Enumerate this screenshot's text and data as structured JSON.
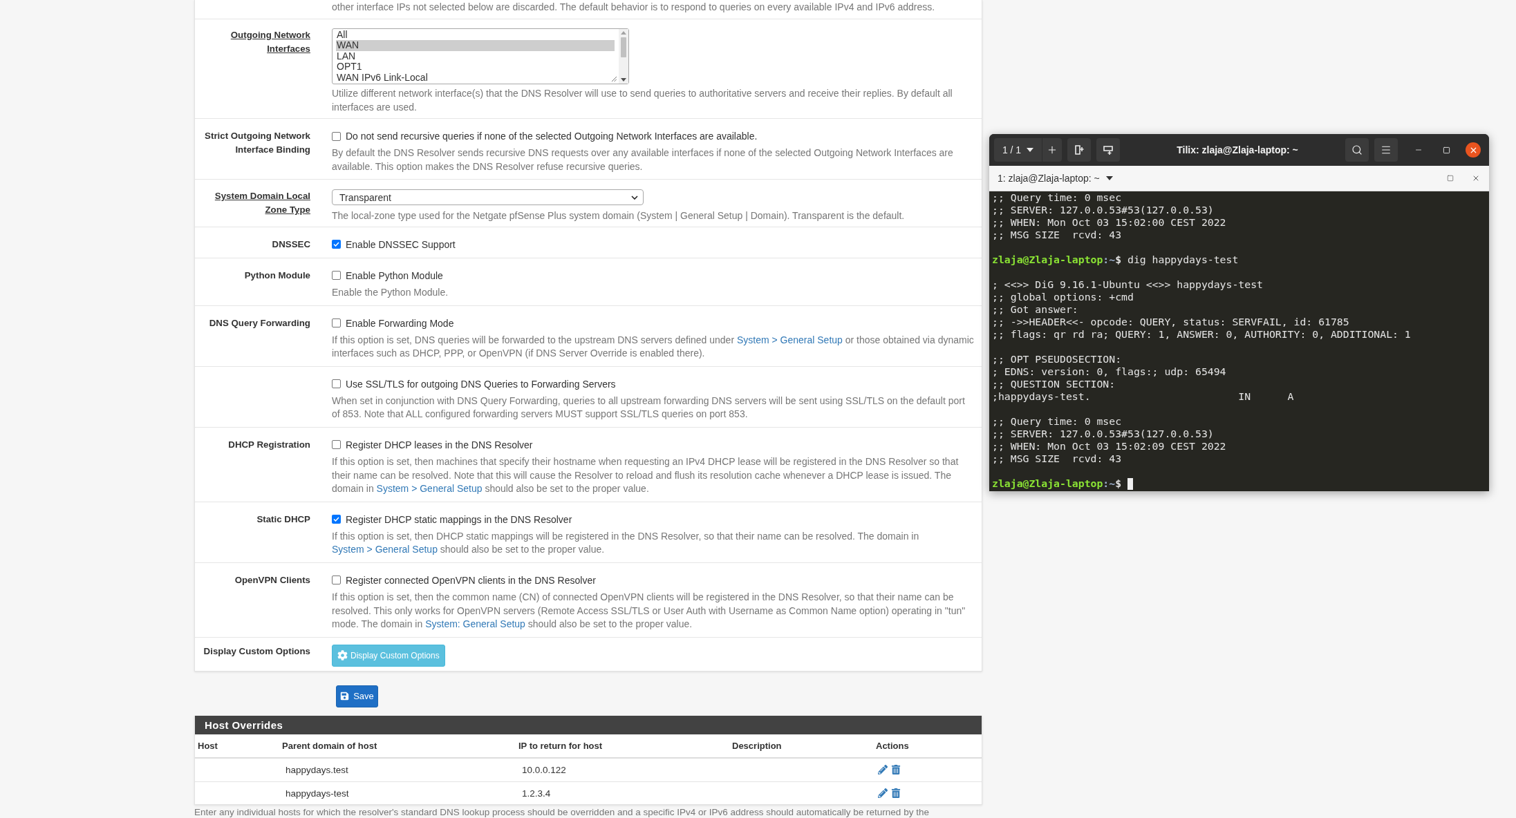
{
  "settings": {
    "top_note": "other interface IPs not selected below are discarded. The default behavior is to respond to queries on every available IPv4 and IPv6 address.",
    "rows": [
      {
        "kind": "listbox",
        "label": "Outgoing Network Interfaces",
        "label_link": true,
        "options": [
          {
            "label": "All",
            "selected": false
          },
          {
            "label": "WAN",
            "selected": true
          },
          {
            "label": "LAN",
            "selected": false
          },
          {
            "label": "OPT1",
            "selected": false
          },
          {
            "label": "WAN IPv6 Link-Local",
            "selected": false
          }
        ],
        "help": [
          {
            "kind": "text",
            "text": "Utilize different network interface(s) that the DNS Resolver will use to send queries to authoritative servers and receive their replies. By default all interfaces are used."
          }
        ]
      },
      {
        "kind": "checkbox",
        "label": "Strict Outgoing Network Interface Binding",
        "label_link": false,
        "checkbox_label": "Do not send recursive queries if none of the selected Outgoing Network Interfaces are available.",
        "checked": false,
        "help": [
          {
            "kind": "text",
            "text": "By default the DNS Resolver sends recursive DNS requests over any available interfaces if none of the selected Outgoing Network Interfaces are available. This option makes the DNS Resolver refuse recursive queries."
          }
        ]
      },
      {
        "kind": "select",
        "label": "System Domain Local Zone Type",
        "label_link": true,
        "value": "Transparent",
        "help": [
          {
            "kind": "text",
            "text": "The local-zone type used for the Netgate pfSense Plus system domain (System | General Setup | Domain). Transparent is the default."
          }
        ]
      },
      {
        "kind": "checkbox",
        "label": "DNSSEC",
        "label_link": false,
        "checkbox_label": "Enable DNSSEC Support",
        "checked": true
      },
      {
        "kind": "checkbox",
        "label": "Python Module",
        "label_link": false,
        "checkbox_label": "Enable Python Module",
        "checked": false,
        "help": [
          {
            "kind": "text",
            "text": "Enable the Python Module."
          }
        ]
      },
      {
        "kind": "checkbox",
        "label": "DNS Query Forwarding",
        "label_link": false,
        "checkbox_label": "Enable Forwarding Mode",
        "checked": false,
        "help": [
          {
            "kind": "text",
            "text": "If this option is set, DNS queries will be forwarded to the upstream DNS servers defined under "
          },
          {
            "kind": "link",
            "text": "System > General Setup"
          },
          {
            "kind": "text",
            "text": " or those obtained via dynamic interfaces such as DHCP, PPP, or OpenVPN (if DNS Server Override is enabled there)."
          }
        ]
      },
      {
        "kind": "checkbox",
        "checkbox_label": "Use SSL/TLS for outgoing DNS Queries to Forwarding Servers",
        "checked": false,
        "help": [
          {
            "kind": "text",
            "text": "When set in conjunction with DNS Query Forwarding, queries to all upstream forwarding DNS servers will be sent using SSL/TLS on the default port of 853. Note that ALL configured forwarding servers MUST support SSL/TLS queries on port 853."
          }
        ]
      },
      {
        "kind": "checkbox",
        "label": "DHCP Registration",
        "label_link": false,
        "checkbox_label": "Register DHCP leases in the DNS Resolver",
        "checked": false,
        "help": [
          {
            "kind": "text",
            "text": "If this option is set, then machines that specify their hostname when requesting an IPv4 DHCP lease will be registered in the DNS Resolver so that their name can be resolved. Note that this will cause the Resolver to reload and flush its resolution cache whenever a DHCP lease is issued. The domain in "
          },
          {
            "kind": "link",
            "text": "System > General Setup"
          },
          {
            "kind": "text",
            "text": " should also be set to the proper value."
          }
        ]
      },
      {
        "kind": "checkbox",
        "label": "Static DHCP",
        "label_link": false,
        "checkbox_label": "Register DHCP static mappings in the DNS Resolver",
        "checked": true,
        "help": [
          {
            "kind": "text",
            "text": "If this option is set, then DHCP static mappings will be registered in the DNS Resolver, so that their name can be resolved. The domain in "
          },
          {
            "kind": "link",
            "text": "System > General Setup"
          },
          {
            "kind": "text",
            "text": " should also be set to the proper value."
          }
        ]
      },
      {
        "kind": "checkbox",
        "label": "OpenVPN Clients",
        "label_link": false,
        "checkbox_label": "Register connected OpenVPN clients in the DNS Resolver",
        "checked": false,
        "help": [
          {
            "kind": "text",
            "text": "If this option is set, then the common name (CN) of connected OpenVPN clients will be registered in the DNS Resolver, so that their name can be resolved. This only works for OpenVPN servers (Remote Access SSL/TLS or User Auth with Username as Common Name option) operating in \"tun\" mode. The domain in "
          },
          {
            "kind": "link",
            "text": "System: General Setup"
          },
          {
            "kind": "text",
            "text": " should also be set to the proper value."
          }
        ]
      },
      {
        "kind": "button",
        "label": "Display Custom Options",
        "label_link": false,
        "button": "Display Custom Options"
      }
    ]
  },
  "save_button": "Save",
  "host_overrides": {
    "title": "Host Overrides",
    "columns": [
      "Host",
      "Parent domain of host",
      "IP to return for host",
      "Description",
      "Actions"
    ],
    "rows": [
      {
        "parent_domain": "happydays.test",
        "ip": "10.0.0.122"
      },
      {
        "parent_domain": "happydays-test",
        "ip": "1.2.3.4"
      }
    ],
    "note": "Enter any individual hosts for which the resolver's standard DNS lookup process should be overridden and a specific IPv4 or IPv6 address should automatically be returned by the"
  },
  "terminal": {
    "session": "1 / 1",
    "title": "Tilix: zlaja@Zlaja-laptop: ~",
    "tab": "1: zlaja@Zlaja-laptop: ~",
    "blocks": [
      {
        "kind": "output",
        "lines": [
          ";; Query time: 0 msec",
          ";; SERVER: 127.0.0.53#53(127.0.0.53)",
          ";; WHEN: Mon Oct 03 15:02:00 CEST 2022",
          ";; MSG SIZE  rcvd: 43"
        ]
      },
      {
        "kind": "prompt",
        "user": "zlaja@Zlaja-laptop",
        "path": ":~",
        "symbol": "$",
        "command": "dig happydays-test",
        "cursor": false
      },
      {
        "kind": "output",
        "lines": [
          "; <<>> DiG 9.16.1-Ubuntu <<>> happydays-test",
          ";; global options: +cmd",
          ";; Got answer:",
          ";; ->>HEADER<<- opcode: QUERY, status: SERVFAIL, id: 61785",
          ";; flags: qr rd ra; QUERY: 1, ANSWER: 0, AUTHORITY: 0, ADDITIONAL: 1"
        ]
      },
      {
        "kind": "output",
        "lines": [
          ";; OPT PSEUDOSECTION:",
          "; EDNS: version: 0, flags:; udp: 65494",
          ";; QUESTION SECTION:",
          ";happydays-test.                        IN      A"
        ]
      },
      {
        "kind": "output",
        "lines": [
          ";; Query time: 0 msec",
          ";; SERVER: 127.0.0.53#53(127.0.0.53)",
          ";; WHEN: Mon Oct 03 15:02:09 CEST 2022",
          ";; MSG SIZE  rcvd: 43"
        ]
      },
      {
        "kind": "prompt",
        "user": "zlaja@Zlaja-laptop",
        "path": ":~",
        "symbol": "$",
        "cursor": true
      }
    ]
  }
}
